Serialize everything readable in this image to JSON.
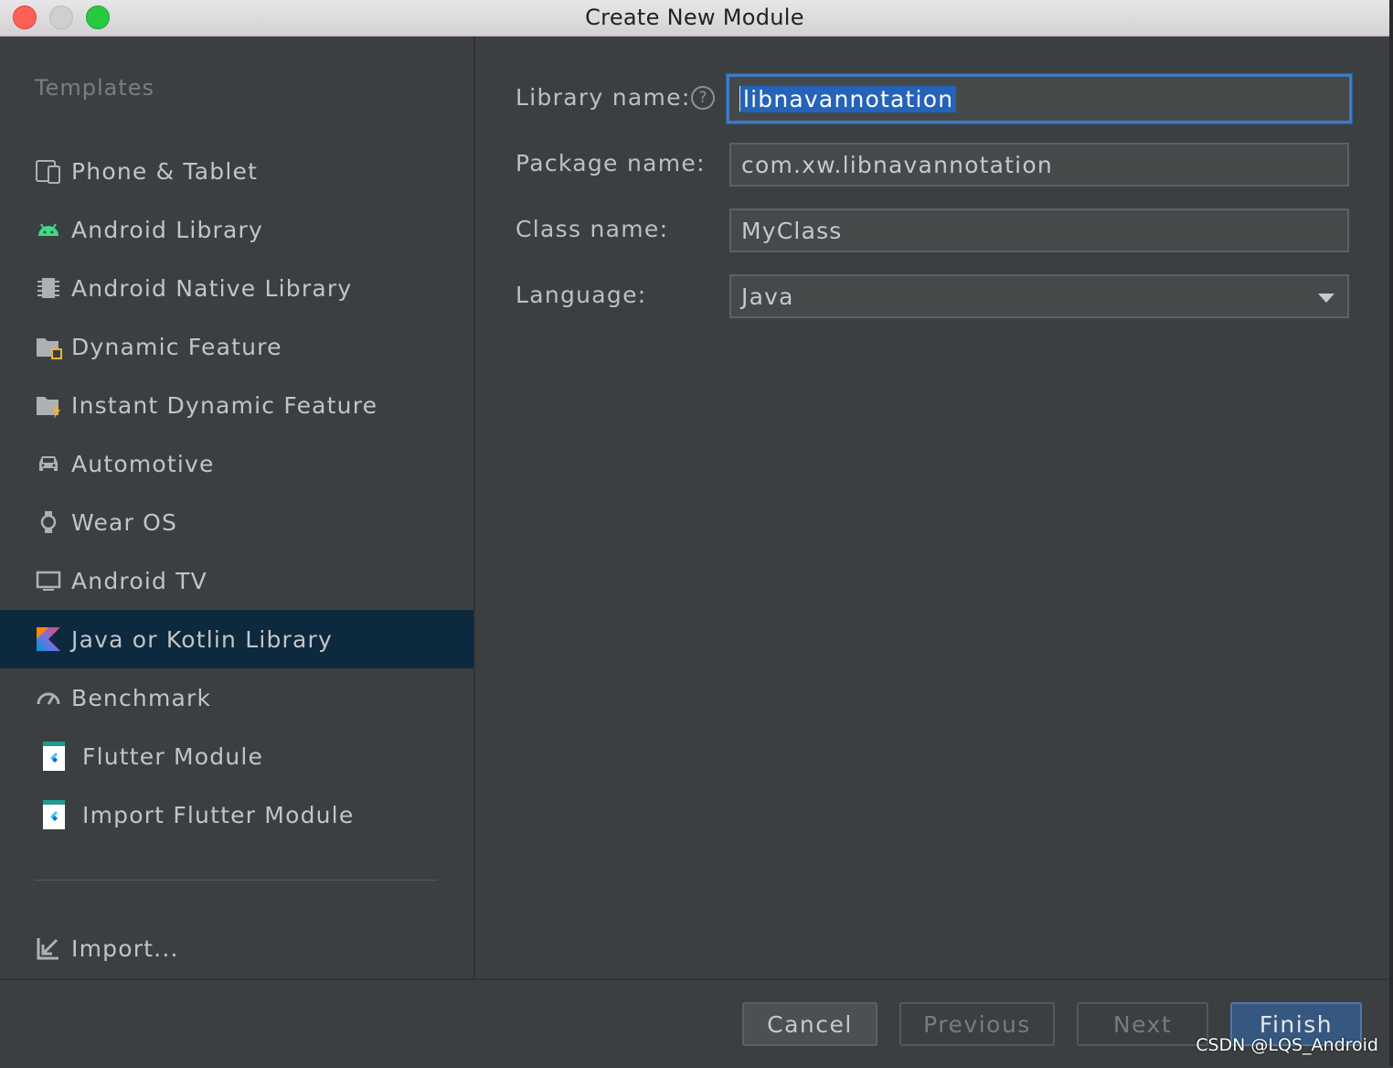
{
  "window": {
    "title": "Create New Module"
  },
  "sidebar": {
    "section_title": "Templates",
    "items": [
      {
        "label": "Phone & Tablet",
        "icon": "phone-tablet-icon"
      },
      {
        "label": "Android Library",
        "icon": "android-icon"
      },
      {
        "label": "Android Native Library",
        "icon": "native-chip-icon"
      },
      {
        "label": "Dynamic Feature",
        "icon": "folder-module-icon"
      },
      {
        "label": "Instant Dynamic Feature",
        "icon": "folder-lightning-icon"
      },
      {
        "label": "Automotive",
        "icon": "car-icon"
      },
      {
        "label": "Wear OS",
        "icon": "watch-icon"
      },
      {
        "label": "Android TV",
        "icon": "tv-icon"
      },
      {
        "label": "Java or Kotlin Library",
        "icon": "kotlin-icon",
        "selected": true
      },
      {
        "label": "Benchmark",
        "icon": "gauge-icon"
      },
      {
        "label": "Flutter Module",
        "icon": "flutter-icon"
      },
      {
        "label": "Import Flutter Module",
        "icon": "flutter-icon"
      }
    ],
    "import_label": "Import..."
  },
  "form": {
    "library_name": {
      "label": "Library name:",
      "value": "libnavannotation"
    },
    "package_name": {
      "label": "Package name:",
      "value": "com.xw.libnavannotation"
    },
    "class_name": {
      "label": "Class name:",
      "value": "MyClass"
    },
    "language": {
      "label": "Language:",
      "value": "Java"
    }
  },
  "footer": {
    "cancel": "Cancel",
    "previous": "Previous",
    "next": "Next",
    "finish": "Finish"
  },
  "watermark": "CSDN @LQS_Android",
  "colors": {
    "background": "#3c3f41",
    "selection": "#0d293e",
    "focus": "#3d7bc4",
    "primary_button": "#365880"
  }
}
